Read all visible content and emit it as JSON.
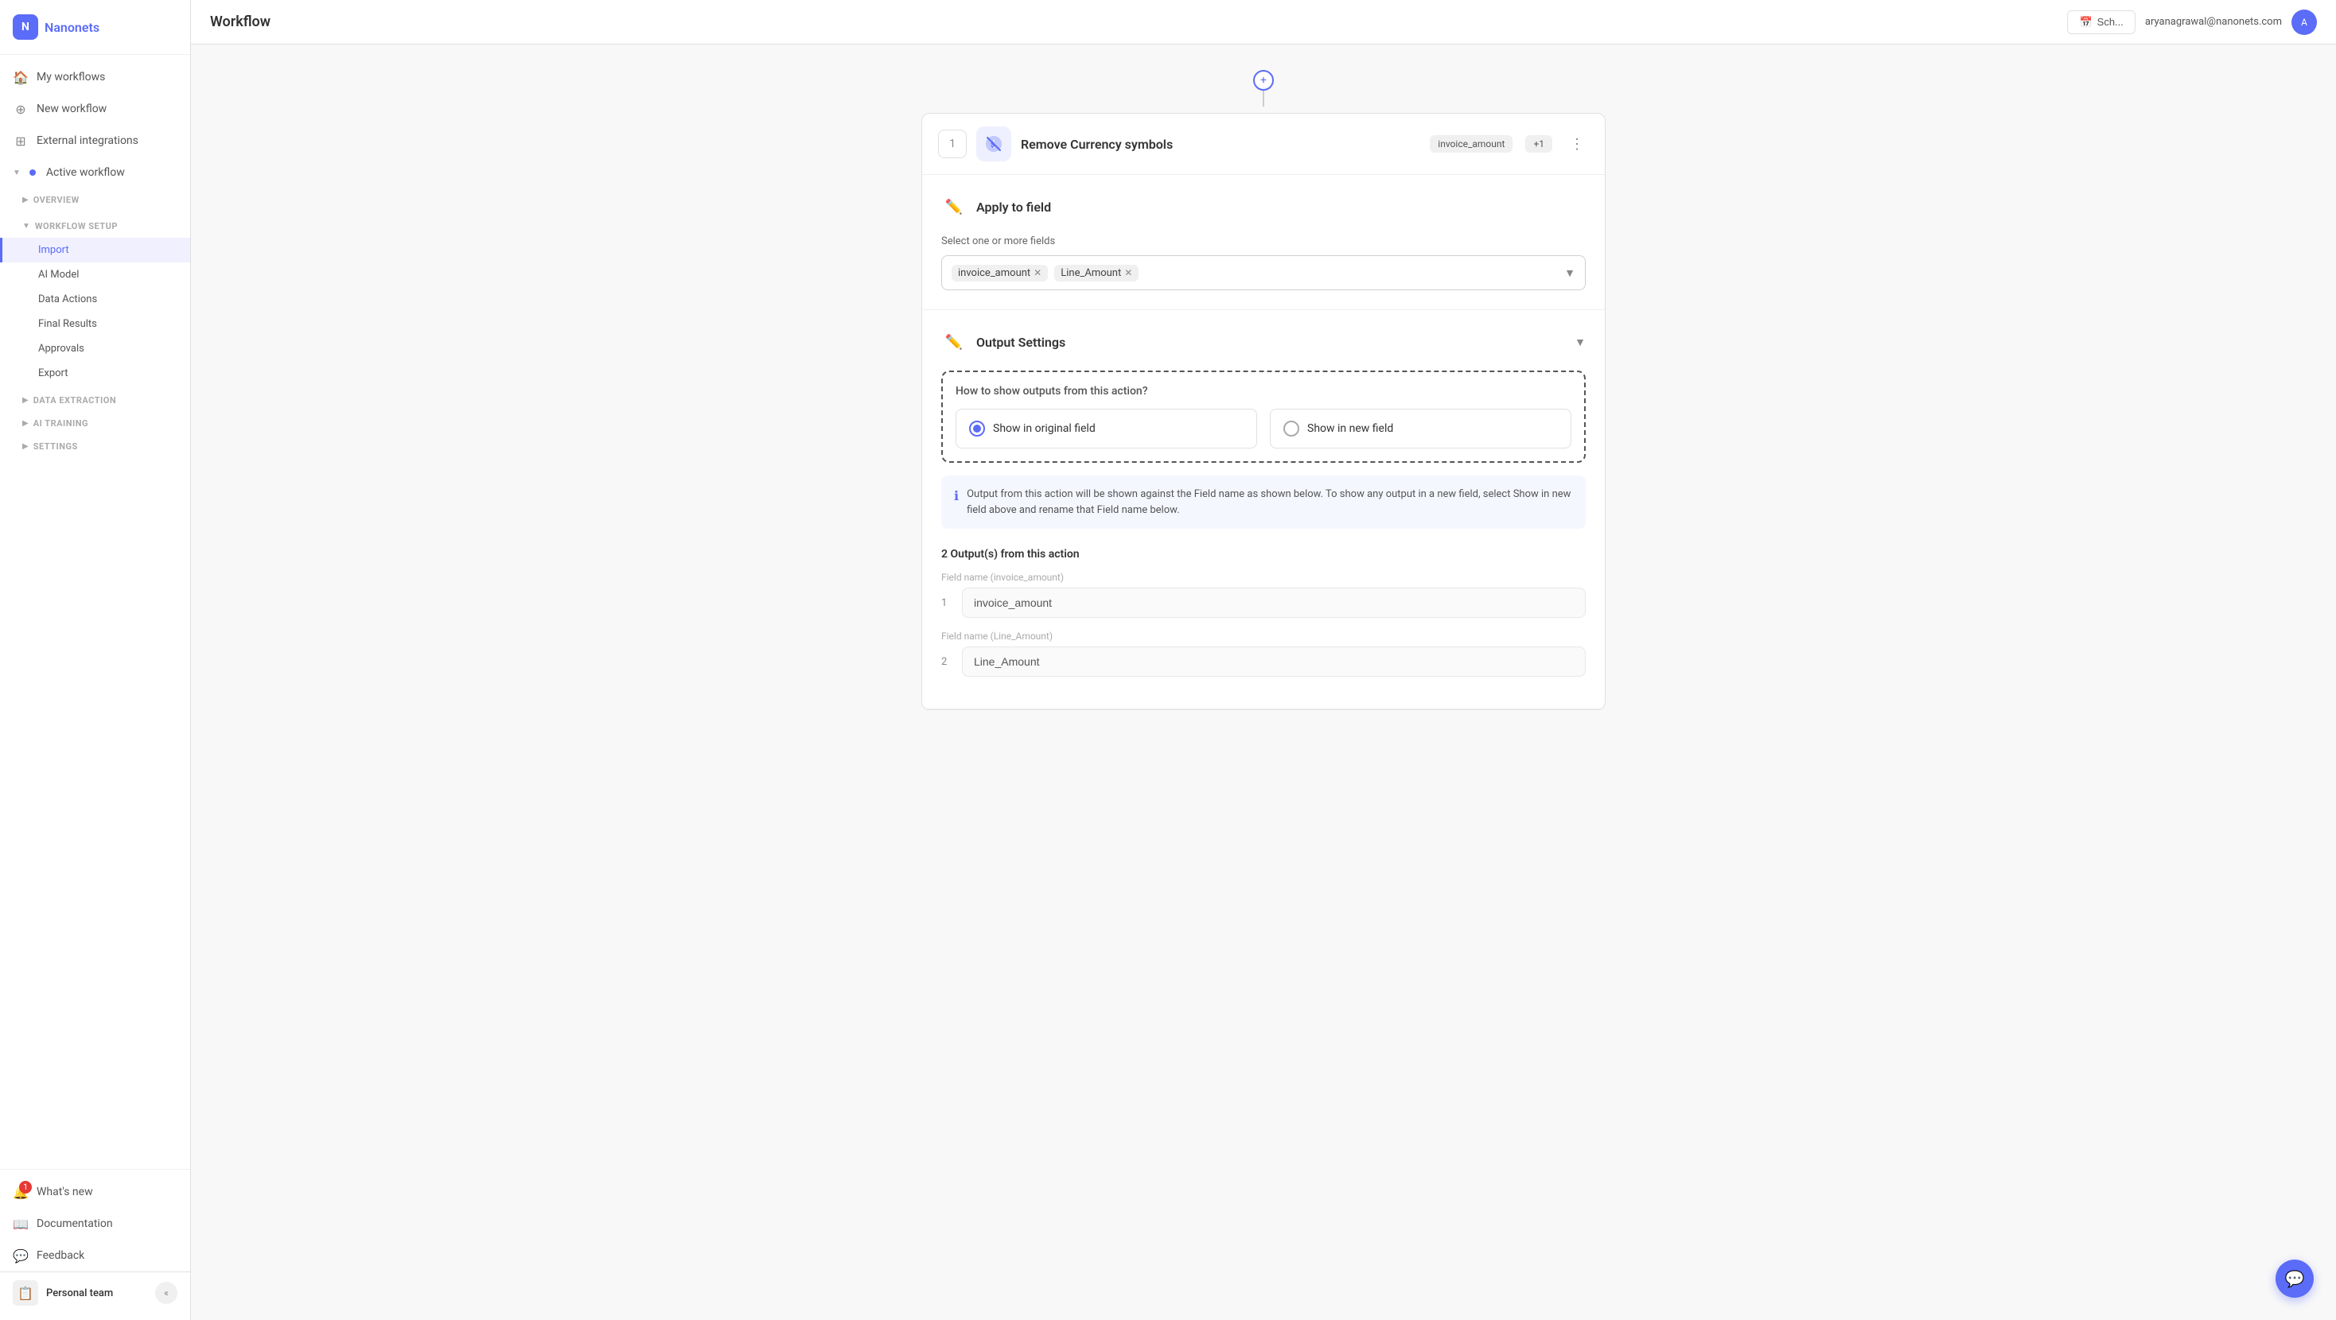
{
  "app": {
    "name": "Nanonets",
    "logo_text": "N"
  },
  "topbar": {
    "title": "Workflow",
    "user_email": "aryanagrawal@nanonets.com",
    "btn_label": "Sch..."
  },
  "sidebar": {
    "nav_items": [
      {
        "id": "my-workflows",
        "label": "My workflows",
        "icon": "🏠"
      },
      {
        "id": "new-workflow",
        "label": "New workflow",
        "icon": "➕"
      },
      {
        "id": "external-integrations",
        "label": "External integrations",
        "icon": "🔗"
      },
      {
        "id": "active-workflow",
        "label": "Active workflow",
        "icon": "●",
        "active_dot": true,
        "expandable": true,
        "expanded": true
      }
    ],
    "workflow_sections": [
      {
        "id": "overview",
        "label": "OVERVIEW",
        "expanded": false
      },
      {
        "id": "workflow-setup",
        "label": "WORKFLOW SETUP",
        "expanded": true,
        "sub_items": [
          {
            "id": "import",
            "label": "Import",
            "active": true
          },
          {
            "id": "ai-model",
            "label": "AI Model",
            "active": false
          },
          {
            "id": "data-actions",
            "label": "Data Actions",
            "active": false
          },
          {
            "id": "final-results",
            "label": "Final Results",
            "active": false
          },
          {
            "id": "approvals",
            "label": "Approvals",
            "active": false
          },
          {
            "id": "export",
            "label": "Export",
            "active": false
          }
        ]
      },
      {
        "id": "data-extraction",
        "label": "DATA EXTRACTION",
        "expanded": false
      },
      {
        "id": "ai-training",
        "label": "AI TRAINING",
        "expanded": false
      },
      {
        "id": "settings",
        "label": "SETTINGS",
        "expanded": false
      }
    ],
    "bottom_items": [
      {
        "id": "whats-new",
        "label": "What's new",
        "icon": "🔔",
        "badge": "1"
      },
      {
        "id": "documentation",
        "label": "Documentation",
        "icon": "📖"
      },
      {
        "id": "feedback",
        "label": "Feedback",
        "icon": "💬"
      }
    ],
    "personal_team": {
      "label": "Personal team",
      "icon": "📋",
      "expanded": true
    }
  },
  "workflow": {
    "step_number": "1",
    "step_title": "Remove Currency symbols",
    "tag1": "invoice_amount",
    "tag2": "+1",
    "connector_icon": "+"
  },
  "apply_to_field": {
    "section_title": "Apply to field",
    "field_label": "Select one or more fields",
    "selected_tags": [
      "invoice_amount",
      "Line_Amount"
    ],
    "icon": "✏️"
  },
  "output_settings": {
    "section_title": "Output Settings",
    "question": "How to show outputs from this action?",
    "options": [
      {
        "id": "original",
        "label": "Show in original field",
        "selected": true
      },
      {
        "id": "new",
        "label": "Show in new field",
        "selected": false
      }
    ],
    "info_text": "Output from this action will be shown against the Field name as shown below. To show any output in a new field, select Show in new field above and rename that Field name below.",
    "outputs_label": "2 Output(s) from this action",
    "fields": [
      {
        "number": "1",
        "label_main": "Field name",
        "label_sub": "(invoice_amount)",
        "value": "invoice_amount"
      },
      {
        "number": "2",
        "label_main": "Field name",
        "label_sub": "(Line_Amount)",
        "value": "Line_Amount"
      }
    ]
  }
}
